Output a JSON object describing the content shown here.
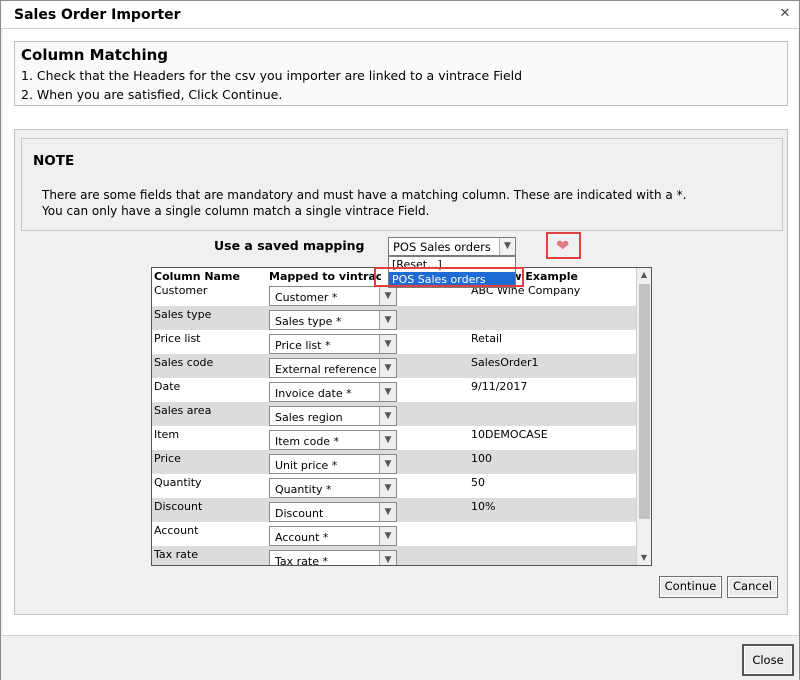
{
  "window": {
    "title": "Sales Order Importer",
    "close_icon": "✕"
  },
  "header": {
    "title": "Column Matching",
    "line1": "1. Check that the Headers for the csv you importer are linked to a vintrace Field",
    "line2": "2. When you are satisfied, Click Continue."
  },
  "note": {
    "title": "NOTE",
    "line1": "There are some fields that are mandatory and must have a matching column. These are indicated with a *.",
    "line2": "You can only have a single column match a single vintrace Field."
  },
  "saved_mapping": {
    "label": "Use a saved mapping",
    "selected": "POS Sales orders",
    "options": [
      "[Reset...]",
      "POS Sales orders"
    ],
    "favorite_icon": "heart-icon"
  },
  "grid": {
    "headers": {
      "column_name": "Column Name",
      "mapped_to": "Mapped to vintrace Field",
      "preview": "Preview Example"
    },
    "rows": [
      {
        "name": "Customer",
        "mapped": "Customer *",
        "example": "ABC Wine Company"
      },
      {
        "name": "Sales type",
        "mapped": "Sales type *",
        "example": ""
      },
      {
        "name": "Price list",
        "mapped": "Price list *",
        "example": "Retail"
      },
      {
        "name": "Sales code",
        "mapped": "External reference",
        "example": "SalesOrder1"
      },
      {
        "name": "Date",
        "mapped": "Invoice date *",
        "example": "9/11/2017"
      },
      {
        "name": "Sales area",
        "mapped": "Sales region",
        "example": ""
      },
      {
        "name": "Item",
        "mapped": "Item code *",
        "example": "10DEMOCASE"
      },
      {
        "name": "Price",
        "mapped": "Unit price *",
        "example": "100"
      },
      {
        "name": "Quantity",
        "mapped": "Quantity *",
        "example": "50"
      },
      {
        "name": "Discount",
        "mapped": "Discount",
        "example": "10%"
      },
      {
        "name": "Account",
        "mapped": "Account *",
        "example": ""
      },
      {
        "name": "Tax rate",
        "mapped": "Tax rate *",
        "example": ""
      }
    ]
  },
  "buttons": {
    "continue": "Continue",
    "cancel": "Cancel",
    "close": "Close"
  },
  "colors": {
    "highlight_border": "#e04040",
    "selected_option": "#1e6bd6",
    "alt_row": "#dcdcdc"
  }
}
